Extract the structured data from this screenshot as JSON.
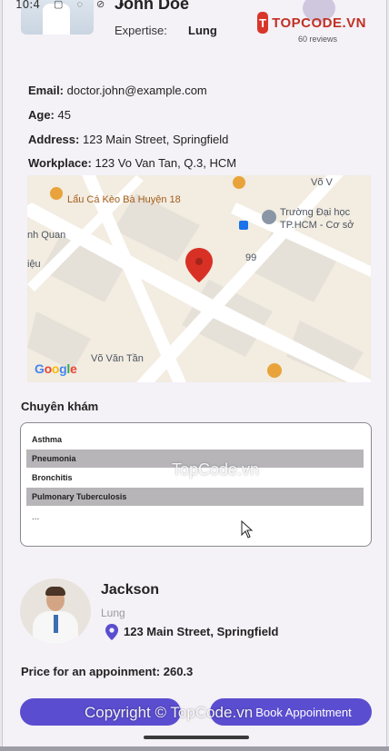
{
  "status_bar": {
    "time": "10:4",
    "icons": "▢ ◌ ⊘ ●"
  },
  "header": {
    "doctor_name": "John Doe",
    "expertise_label": "Expertise:",
    "expertise_value": "Lung",
    "reviews": "60 reviews"
  },
  "logo": {
    "badge": "T",
    "text": "TOPCODE.VN"
  },
  "info": {
    "email_label": "Email:",
    "email_value": "doctor.john@example.com",
    "age_label": "Age:",
    "age_value": "45",
    "address_label": "Address:",
    "address_value": "123 Main Street, Springfield",
    "workplace_label": "Workplace:",
    "workplace_value": "123 Vo Van Tan, Q.3, HCM"
  },
  "map": {
    "labels": {
      "restaurant": "Lẩu Cá Kèo Bà Huyện 18",
      "school": "Trường Đại học",
      "school_sub": "TP.HCM - Cơ sở",
      "street_top": "Võ V",
      "street_left": "nh Quan",
      "street_left2": "iệu",
      "street_bottom": "Võ Văn Tần",
      "street_number": "99"
    },
    "google": [
      "G",
      "o",
      "o",
      "g",
      "l",
      "e"
    ],
    "colors": {
      "land": "#f2ece1",
      "road": "#ffffff",
      "block": "#e6e1d8",
      "pin": "#d93025"
    }
  },
  "specialties": {
    "title": "Chuyên khám",
    "items": [
      "Asthma",
      "Pneumonia",
      "Bronchitis",
      "Pulmonary Tuberculosis"
    ],
    "more": "..."
  },
  "watermarks": {
    "middle": "TopCode.vn",
    "bottom": "Copyright © TopCode.vn"
  },
  "doctor_card": {
    "name": "Jackson",
    "specialty": "Lung",
    "address": "123 Main Street, Springfield"
  },
  "price": {
    "label": "Price for an appoinment: 260.3"
  },
  "buttons": {
    "left_label": "",
    "right_label": "Book Appointment"
  },
  "colors": {
    "accent": "#5a4dcf",
    "pin_purple": "#5a4dcf",
    "logo_red": "#d8362a"
  }
}
